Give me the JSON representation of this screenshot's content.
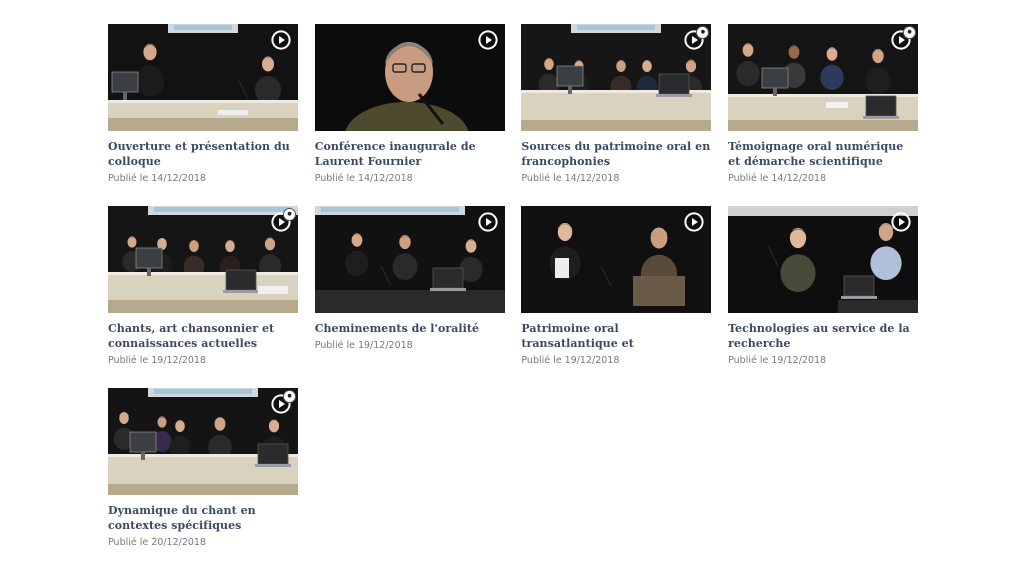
{
  "videos": [
    {
      "title": "Ouverture et présentation du colloque",
      "date": "Publié le 14/12/2018",
      "scene": "panel2",
      "badge": false
    },
    {
      "title": "Conférence inaugurale de Laurent Fournier",
      "date": "Publié le 14/12/2018",
      "scene": "closeup",
      "badge": false
    },
    {
      "title": "Sources du patrimoine oral en francophonies",
      "date": "Publié le 14/12/2018",
      "scene": "panelwide",
      "badge": true
    },
    {
      "title": "Témoignage oral numérique et démarche scientifique",
      "date": "Publié le 14/12/2018",
      "scene": "panel4",
      "badge": true
    },
    {
      "title": "Chants, art chansonnier et connaissances actuelles",
      "date": "Publié le 19/12/2018",
      "scene": "panel5",
      "badge": true
    },
    {
      "title": "Cheminements de l'oralité",
      "date": "Publié le 19/12/2018",
      "scene": "panel3",
      "badge": false
    },
    {
      "title": "Patrimoine oral transatlantique et renouvellement des sources...",
      "date": "Publié le 19/12/2018",
      "scene": "duo",
      "badge": false
    },
    {
      "title": "Technologies au service de la recherche",
      "date": "Publié le 19/12/2018",
      "scene": "duo2",
      "badge": false
    },
    {
      "title": "Dynamique du chant en contextes spécifiques",
      "date": "Publié le 20/12/2018",
      "scene": "panel5b",
      "badge": true
    }
  ],
  "icons": {
    "play": "play-circle-icon",
    "badge": "cc-badge-icon"
  },
  "colors": {
    "title": "#3a4a63",
    "date": "#7a7a7a",
    "background": "#ffffff"
  }
}
